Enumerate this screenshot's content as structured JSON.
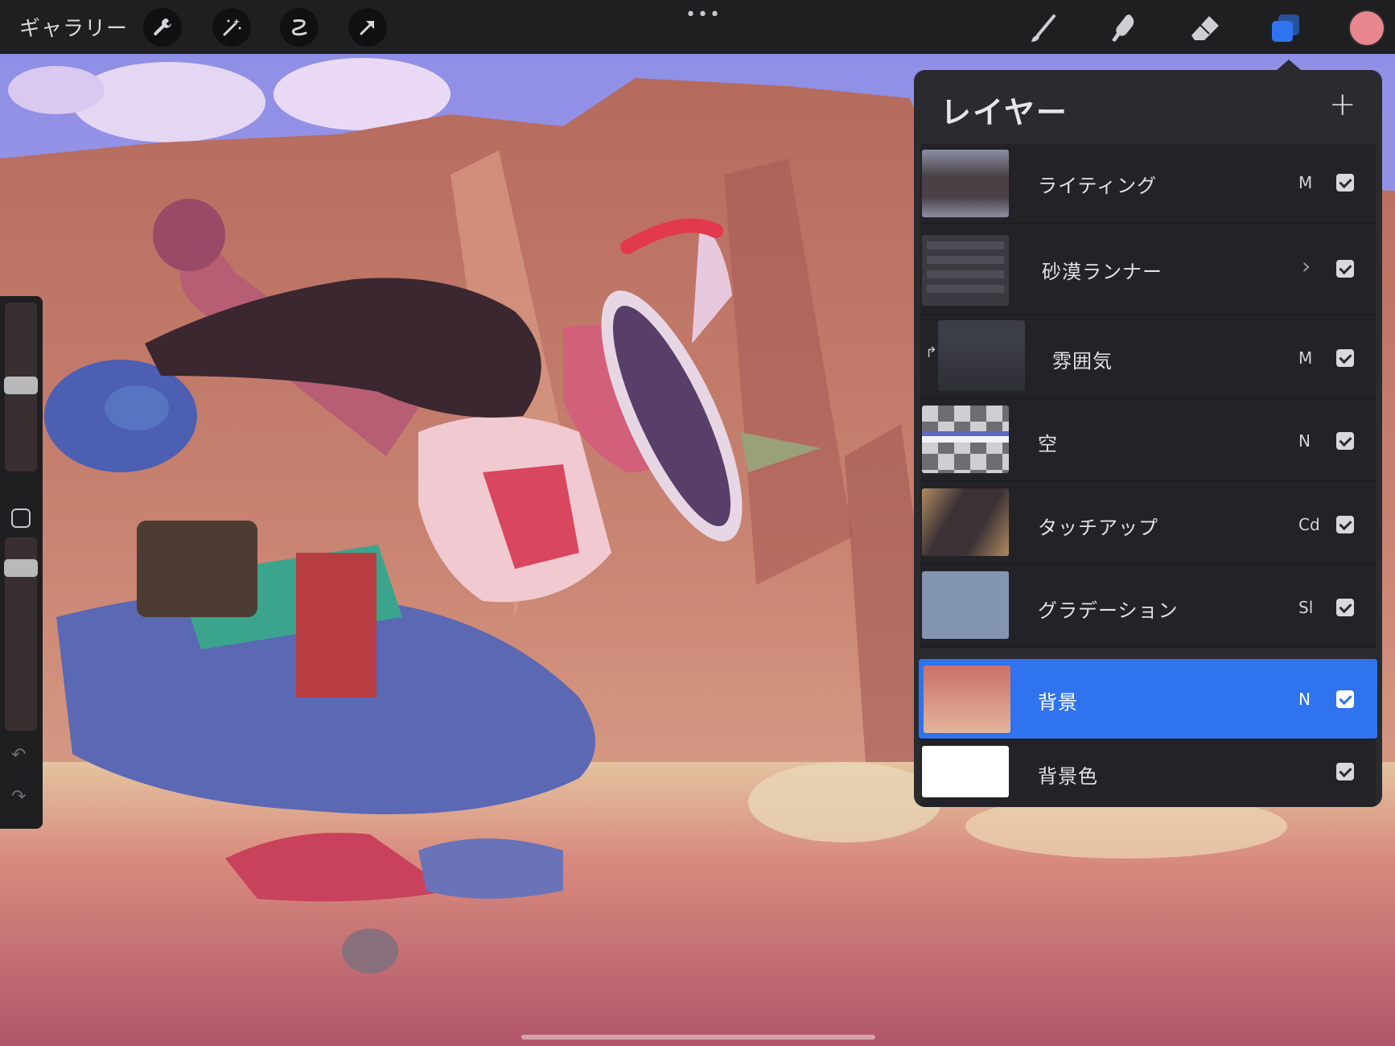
{
  "topbar": {
    "gallery_label": "ギャラリー",
    "more_label": "•••",
    "left_tools": [
      "wrench-icon",
      "magic-wand-icon",
      "selection-icon",
      "transform-icon"
    ],
    "right_tools": [
      "brush-icon",
      "smudge-icon",
      "eraser-icon",
      "layers-icon"
    ],
    "current_color": "#e8878d"
  },
  "sidebar": {
    "undo_label": "↶",
    "redo_label": "↷"
  },
  "layers_panel": {
    "title": "レイヤー",
    "add_label": "+",
    "layers": [
      {
        "name": "ライティング",
        "mode": "M",
        "visible": true
      },
      {
        "name": "砂漠ランナー",
        "mode": "",
        "group": true,
        "visible": true
      },
      {
        "name": "雰囲気",
        "mode": "M",
        "clipped": true,
        "visible": true
      },
      {
        "name": "空",
        "mode": "N",
        "visible": true
      },
      {
        "name": "タッチアップ",
        "mode": "Cd",
        "visible": true
      },
      {
        "name": "グラデーション",
        "mode": "Sl",
        "visible": true
      },
      {
        "name": "背景",
        "mode": "N",
        "selected": true,
        "visible": true
      },
      {
        "name": "背景色",
        "mode": "",
        "visible": true
      }
    ],
    "selected_color": "#2f73ee"
  }
}
